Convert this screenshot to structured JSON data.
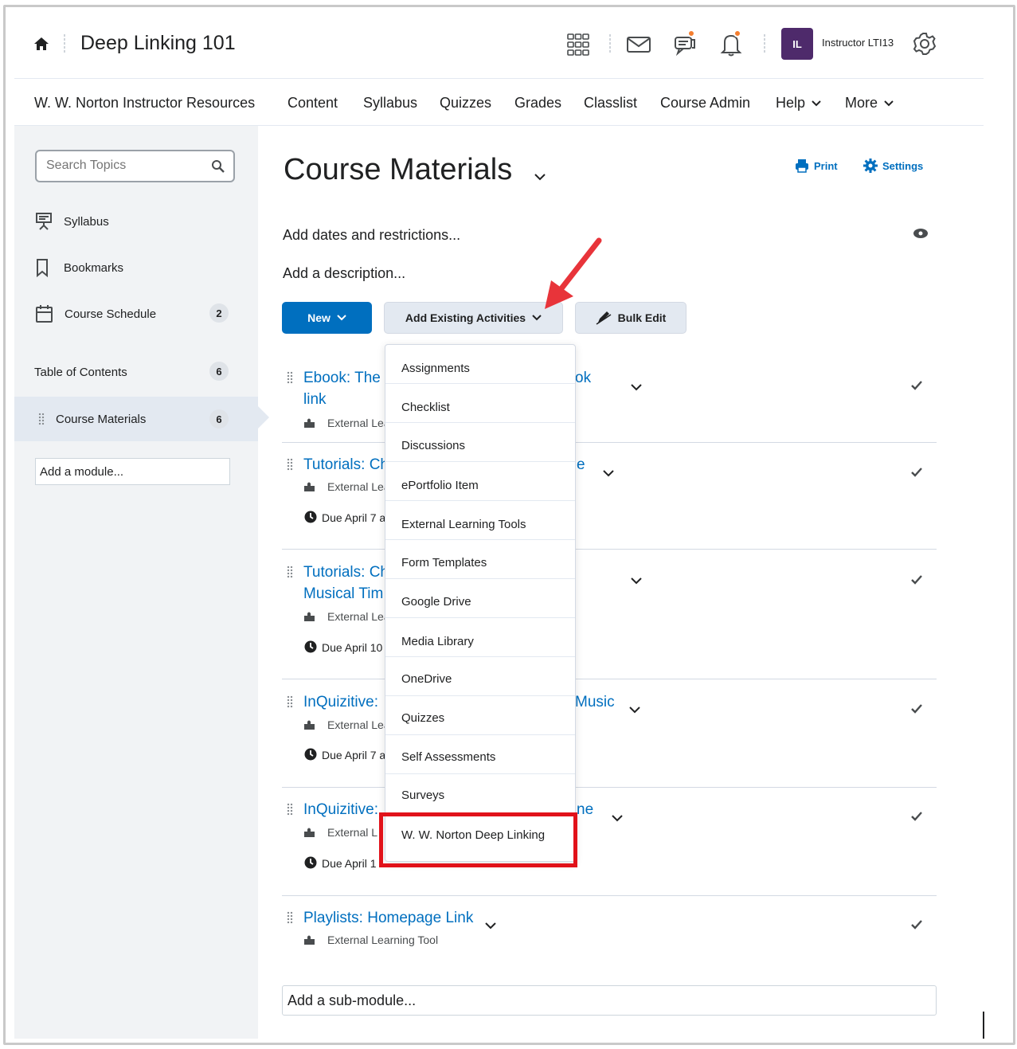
{
  "header": {
    "course_title": "Deep Linking 101",
    "user_initials": "IL",
    "user_name": "Instructor LTI13",
    "icons": [
      "home-icon",
      "apps-grid-icon",
      "email-icon",
      "chat-icon",
      "bell-icon",
      "gear-icon"
    ]
  },
  "navbar": {
    "items": [
      "W. W. Norton Instructor Resources",
      "Content",
      "Syllabus",
      "Quizzes",
      "Grades",
      "Classlist",
      "Course Admin",
      "Help",
      "More"
    ]
  },
  "sidebar": {
    "search_placeholder": "Search Topics",
    "items": [
      {
        "label": "Syllabus"
      },
      {
        "label": "Bookmarks"
      },
      {
        "label": "Course Schedule",
        "count": "2"
      }
    ],
    "toc_label": "Table of Contents",
    "toc_count": "6",
    "module_label": "Course Materials",
    "module_count": "6",
    "add_module": "Add a module..."
  },
  "main": {
    "title": "Course Materials",
    "print": "Print",
    "settings": "Settings",
    "add_dates": "Add dates and restrictions...",
    "add_description": "Add a description...",
    "btn_new": "New",
    "btn_add_existing": "Add Existing Activities",
    "btn_bulk_edit": "Bulk Edit",
    "items": [
      {
        "title_left": "Ebook: The I",
        "title_right": "ok",
        "title_line2": "link",
        "meta": "External Lea"
      },
      {
        "title_left": "Tutorials: Ch",
        "title_right": "e",
        "meta": "External Lea",
        "due": "Due April 7 a"
      },
      {
        "title_left": "Tutorials: Ch",
        "title_line2": "Musical Tim",
        "meta": "External Lea",
        "due": "Due April 10"
      },
      {
        "title_left": "InQuizitive: ",
        "title_right": "Music",
        "meta": "External Lea",
        "due": "Due April 7 a"
      },
      {
        "title_left": "InQuizitive:",
        "title_right": "ne",
        "meta": "External L",
        "due": "Due April 1"
      },
      {
        "title_left": "Playlists: Homepage Link",
        "meta": "External Learning Tool"
      }
    ],
    "add_sub_module": "Add a sub-module..."
  },
  "dropdown": {
    "items": [
      "Assignments",
      "Checklist",
      "Discussions",
      "ePortfolio Item",
      "External Learning Tools",
      "Form Templates",
      "Google Drive",
      "Media Library",
      "OneDrive",
      "Quizzes",
      "Self Assessments",
      "Surveys",
      "W. W. Norton Deep Linking"
    ],
    "highlight_color": "#e1121a",
    "arrow_color": "#e8343a"
  },
  "colors": {
    "primary": "#006fbf",
    "avatar": "#4e2a6b",
    "notification": "#f47e30"
  }
}
